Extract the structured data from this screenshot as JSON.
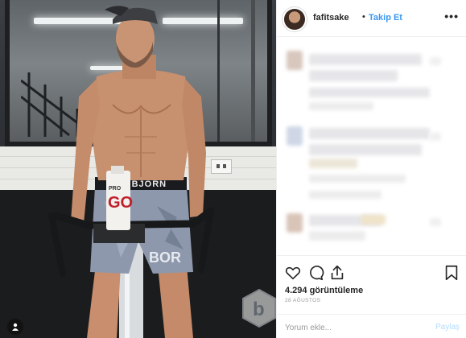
{
  "post": {
    "username": "fafitsake",
    "separator": "•",
    "follow_label": "Takip Et",
    "more_label": "•••"
  },
  "stats": {
    "views": "4.294 görüntüleme",
    "date": "28 AĞUSTOS"
  },
  "comment_box": {
    "placeholder": "Yorum ekle...",
    "post_label": "Paylaş"
  },
  "colors": {
    "accent": "#3897f0",
    "post_disabled": "#b3dbff",
    "text": "#262626",
    "muted": "#999999"
  },
  "icons": [
    "heart-icon",
    "comment-icon",
    "share-icon",
    "bookmark-icon",
    "user-tag-icon",
    "ellipsis-icon"
  ]
}
